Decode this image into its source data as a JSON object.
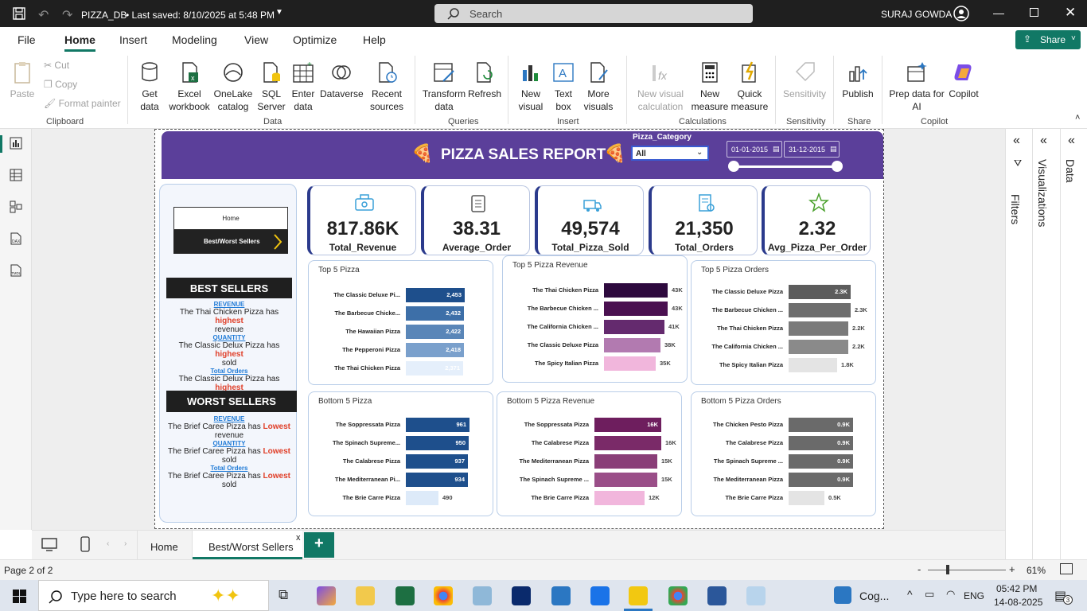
{
  "titlebar": {
    "file_name": "PIZZA_DB",
    "saved": "• Last saved: 8/10/2025 at 5:48 PM",
    "search_placeholder": "Search",
    "user": "SURAJ GOWDA"
  },
  "menu": {
    "items": [
      "File",
      "Home",
      "Insert",
      "Modeling",
      "View",
      "Optimize",
      "Help"
    ],
    "share": "Share"
  },
  "ribbon": {
    "paste": "Paste",
    "cut": "Cut",
    "copy": "Copy",
    "format_painter": "Format painter",
    "get_data": "Get data",
    "excel": "Excel workbook",
    "onelake": "OneLake catalog",
    "sql": "SQL Server",
    "enter_data": "Enter data",
    "dataverse": "Dataverse",
    "recent": "Recent sources",
    "transform": "Transform data",
    "refresh": "Refresh",
    "new_visual": "New visual",
    "text_box": "Text box",
    "more_visuals": "More visuals",
    "new_calc": "New visual calculation",
    "new_measure": "New measure",
    "quick_measure": "Quick measure",
    "sensitivity": "Sensitivity",
    "publish": "Publish",
    "prep_ai": "Prep data for AI",
    "copilot": "Copilot",
    "groups": [
      "Clipboard",
      "Data",
      "Queries",
      "Insert",
      "Calculations",
      "Sensitivity",
      "Share",
      "Copilot"
    ]
  },
  "report": {
    "title": "PIZZA SALES REPORT",
    "category_label": "Pizza_Category",
    "category_value": "All",
    "date_start": "01-01-2015",
    "date_end": "31-12-2015",
    "nav": {
      "home": "Home",
      "best_worst": "Best/Worst Sellers"
    },
    "kpis": [
      {
        "value": "817.86K",
        "label": "Total_Revenue"
      },
      {
        "value": "38.31",
        "label": "Average_Order"
      },
      {
        "value": "49,574",
        "label": "Total_Pizza_Sold"
      },
      {
        "value": "21,350",
        "label": "Total_Orders"
      },
      {
        "value": "2.32",
        "label": "Avg_Pizza_Per_Order"
      }
    ],
    "best": {
      "heading": "BEST SELLERS",
      "items": [
        {
          "hd": "REVENUE",
          "a": "The Thai Chicken Pizza has ",
          "b": "highest",
          "c": "revenue"
        },
        {
          "hd": "QUANTITY",
          "a": "The Classic Delux Pizza has ",
          "b": "highest",
          "c": "sold"
        },
        {
          "hd": "Total Orders",
          "a": "The Classic Delux Pizza has ",
          "b": "highest",
          "c": "sold"
        }
      ]
    },
    "worst": {
      "heading": "WORST SELLERS",
      "items": [
        {
          "hd": "REVENUE",
          "a": "The Brief Caree Pizza has ",
          "b": "Lowest",
          "c": "revenue"
        },
        {
          "hd": "QUANTITY",
          "a": "The Brief Caree Pizza has ",
          "b": "Lowest",
          "c": "sold"
        },
        {
          "hd": "Total Orders",
          "a": "The Brief Caree Pizza has ",
          "b": "Lowest",
          "c": "sold"
        }
      ]
    }
  },
  "chart_data": [
    {
      "type": "bar",
      "title": "Top 5 Pizza",
      "categories": [
        "The Classic Deluxe Pi...",
        "The Barbecue Chicke...",
        "The Hawaiian Pizza",
        "The Pepperoni Pizza",
        "The Thai Chicken Pizza"
      ],
      "values": [
        2453,
        2432,
        2422,
        2418,
        2371
      ],
      "labels": [
        "2,453",
        "2,432",
        "2,422",
        "2,418",
        "2,371"
      ],
      "colors": [
        "#1e4f8c",
        "#3d6fa8",
        "#5a86b8",
        "#7aa0cc",
        "#e5effb"
      ]
    },
    {
      "type": "bar",
      "title": "Top 5 Pizza Revenue",
      "categories": [
        "The Thai Chicken Pizza",
        "The Barbecue Chicken ...",
        "The California Chicken ...",
        "The Classic Deluxe Pizza",
        "The Spicy Italian Pizza"
      ],
      "values": [
        43,
        43,
        41,
        38,
        35
      ],
      "labels": [
        "43K",
        "43K",
        "41K",
        "38K",
        "35K"
      ],
      "colors": [
        "#2e0a3e",
        "#4a1050",
        "#642a6e",
        "#b27ab0",
        "#f1b6dc"
      ]
    },
    {
      "type": "bar",
      "title": "Top 5 Pizza Orders",
      "categories": [
        "The Classic Deluxe Pizza",
        "The Barbecue Chicken ...",
        "The Thai Chicken Pizza",
        "The California Chicken ...",
        "The Spicy Italian Pizza"
      ],
      "values": [
        2.3,
        2.3,
        2.2,
        2.2,
        1.8
      ],
      "labels": [
        "2.3K",
        "2.3K",
        "2.2K",
        "2.2K",
        "1.8K"
      ],
      "colors": [
        "#5c5c5c",
        "#6e6e6e",
        "#7a7a7a",
        "#8a8a8a",
        "#e4e4e4"
      ]
    },
    {
      "type": "bar",
      "title": "Bottom 5 Pizza",
      "categories": [
        "The Soppressata Pizza",
        "The Spinach Supreme...",
        "The Calabrese Pizza",
        "The Mediterranean Pi...",
        "The Brie Carre Pizza"
      ],
      "values": [
        961,
        950,
        937,
        934,
        490
      ],
      "labels": [
        "961",
        "950",
        "937",
        "934",
        "490"
      ],
      "colors": [
        "#1e4f8c",
        "#1e4f8c",
        "#1e4f8c",
        "#1e4f8c",
        "#ddeaf9"
      ]
    },
    {
      "type": "bar",
      "title": "Bottom 5 Pizza Revenue",
      "categories": [
        "The Soppressata Pizza",
        "The Calabrese Pizza",
        "The Mediterranean Pizza",
        "The Spinach Supreme ...",
        "The Brie Carre Pizza"
      ],
      "values": [
        16,
        16,
        15,
        15,
        12
      ],
      "labels": [
        "16K",
        "16K",
        "15K",
        "15K",
        "12K"
      ],
      "colors": [
        "#6e1e5e",
        "#7a2a68",
        "#8a3e78",
        "#9a4e88",
        "#f1b6dc"
      ]
    },
    {
      "type": "bar",
      "title": "Bottom 5 Pizza Orders",
      "categories": [
        "The Chicken Pesto Pizza",
        "The Calabrese Pizza",
        "The Spinach Supreme ...",
        "The Mediterranean Pizza",
        "The Brie Carre Pizza"
      ],
      "values": [
        0.9,
        0.9,
        0.9,
        0.9,
        0.5
      ],
      "labels": [
        "0.9K",
        "0.9K",
        "0.9K",
        "0.9K",
        "0.5K"
      ],
      "colors": [
        "#6a6a6a",
        "#6a6a6a",
        "#6a6a6a",
        "#6a6a6a",
        "#e4e4e4"
      ]
    }
  ],
  "panes": {
    "filters": "Filters",
    "visualizations": "Visualizations",
    "data": "Data"
  },
  "tabs": {
    "home": "Home",
    "best_worst": "Best/Worst Sellers",
    "close": "x",
    "add": "+"
  },
  "status": {
    "page": "Page 2 of 2",
    "zoom": "61%"
  },
  "taskbar": {
    "search_placeholder": "Type here to search",
    "cog": "Cog...",
    "lang": "ENG",
    "time": "05:42 PM",
    "date": "14-08-2025",
    "notif": "3"
  }
}
